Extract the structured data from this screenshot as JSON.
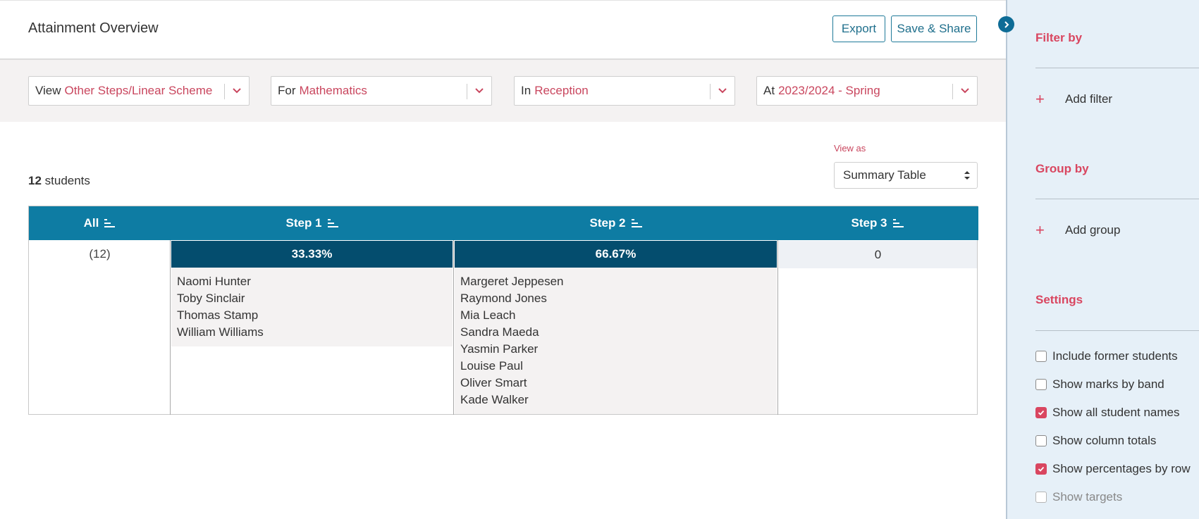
{
  "header": {
    "title": "Attainment Overview",
    "export_label": "Export",
    "share_label": "Save & Share"
  },
  "filters": [
    {
      "label": "View",
      "value": "Other Steps/Linear Scheme"
    },
    {
      "label": "For",
      "value": "Mathematics"
    },
    {
      "label": "In",
      "value": "Reception"
    },
    {
      "label": "At",
      "value": "2023/2024 - Spring"
    }
  ],
  "view_as": {
    "label": "View as",
    "selected": "Summary Table"
  },
  "students": {
    "count": "12",
    "suffix": " students"
  },
  "table": {
    "columns": [
      "All",
      "Step 1",
      "Step 2",
      "Step 3"
    ],
    "all_count": "(12)",
    "step1": {
      "percent": "33.33%",
      "names": [
        "Naomi Hunter",
        "Toby Sinclair",
        "Thomas Stamp",
        "William Williams"
      ]
    },
    "step2": {
      "percent": "66.67%",
      "names": [
        "Margeret Jeppesen",
        "Raymond Jones",
        "Mia Leach",
        "Sandra Maeda",
        "Yasmin Parker",
        "Louise Paul",
        "Oliver Smart",
        "Kade Walker"
      ]
    },
    "step3": {
      "value": "0"
    }
  },
  "sidebar": {
    "filter_title": "Filter by",
    "add_filter": "Add filter",
    "group_title": "Group by",
    "add_group": "Add group",
    "settings_title": "Settings",
    "settings": [
      {
        "label": "Include former students",
        "checked": false,
        "disabled": false
      },
      {
        "label": "Show marks by band",
        "checked": false,
        "disabled": false
      },
      {
        "label": "Show all student names",
        "checked": true,
        "disabled": false
      },
      {
        "label": "Show column totals",
        "checked": false,
        "disabled": false
      },
      {
        "label": "Show percentages by row",
        "checked": true,
        "disabled": false
      },
      {
        "label": "Show targets",
        "checked": false,
        "disabled": true
      }
    ]
  },
  "colors": {
    "accent": "#d94660",
    "header_blue": "#0e7ca3",
    "dark_blue": "#044d6e"
  }
}
